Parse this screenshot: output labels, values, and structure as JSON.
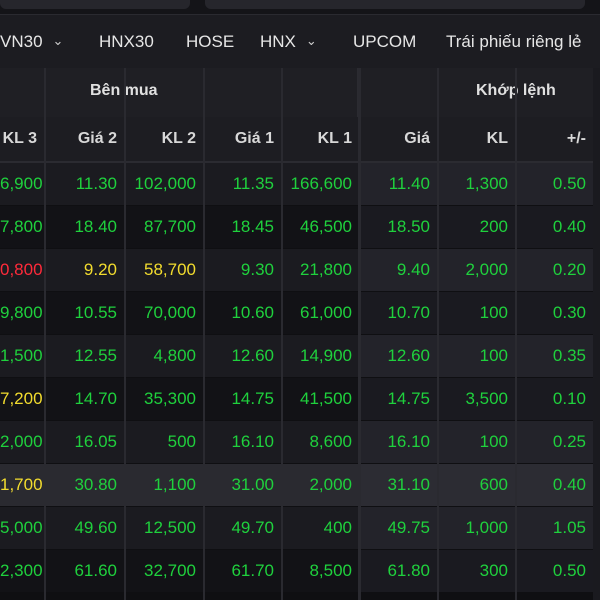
{
  "nav": {
    "items": [
      {
        "label": "VN30",
        "dropdown": true
      },
      {
        "label": "HNX30",
        "dropdown": false
      },
      {
        "label": "HOSE",
        "dropdown": false
      },
      {
        "label": "HNX",
        "dropdown": true
      },
      {
        "label": "UPCOM",
        "dropdown": false
      },
      {
        "label": "Trái phiếu riêng lẻ",
        "dropdown": false
      }
    ],
    "chevron": "⌄"
  },
  "groups": {
    "buy": "Bên mua",
    "match": "Khớp lệnh"
  },
  "columns": [
    "KL 3",
    "Giá 2",
    "KL 2",
    "Giá 1",
    "KL 1",
    "Giá",
    "KL",
    "+/-"
  ],
  "colors": {
    "green": "#1fd13d",
    "yellow": "#f2dc2e",
    "red": "#ff2a3a"
  },
  "rows": [
    {
      "cells": [
        "6,900",
        "11.30",
        "102,000",
        "11.35",
        "166,600",
        "11.40",
        "1,300",
        "0.50"
      ],
      "colors": [
        "green",
        "green",
        "green",
        "green",
        "green",
        "green",
        "green",
        "green"
      ]
    },
    {
      "cells": [
        "7,800",
        "18.40",
        "87,700",
        "18.45",
        "46,500",
        "18.50",
        "200",
        "0.40"
      ],
      "colors": [
        "green",
        "green",
        "green",
        "green",
        "green",
        "green",
        "green",
        "green"
      ]
    },
    {
      "cells": [
        "0,800",
        "9.20",
        "58,700",
        "9.30",
        "21,800",
        "9.40",
        "2,000",
        "0.20"
      ],
      "colors": [
        "red",
        "yellow",
        "yellow",
        "green",
        "green",
        "green",
        "green",
        "green"
      ]
    },
    {
      "cells": [
        "9,800",
        "10.55",
        "70,000",
        "10.60",
        "61,000",
        "10.70",
        "100",
        "0.30"
      ],
      "colors": [
        "green",
        "green",
        "green",
        "green",
        "green",
        "green",
        "green",
        "green"
      ]
    },
    {
      "cells": [
        "1,500",
        "12.55",
        "4,800",
        "12.60",
        "14,900",
        "12.60",
        "100",
        "0.35"
      ],
      "colors": [
        "green",
        "green",
        "green",
        "green",
        "green",
        "green",
        "green",
        "green"
      ]
    },
    {
      "cells": [
        "7,200",
        "14.70",
        "35,300",
        "14.75",
        "41,500",
        "14.75",
        "3,500",
        "0.10"
      ],
      "colors": [
        "yellow",
        "green",
        "green",
        "green",
        "green",
        "green",
        "green",
        "green"
      ]
    },
    {
      "cells": [
        "2,000",
        "16.05",
        "500",
        "16.10",
        "8,600",
        "16.10",
        "100",
        "0.25"
      ],
      "colors": [
        "green",
        "green",
        "green",
        "green",
        "green",
        "green",
        "green",
        "green"
      ]
    },
    {
      "cells": [
        "1,700",
        "30.80",
        "1,100",
        "31.00",
        "2,000",
        "31.10",
        "600",
        "0.40"
      ],
      "colors": [
        "yellow",
        "green",
        "green",
        "green",
        "green",
        "green",
        "green",
        "green"
      ]
    },
    {
      "cells": [
        "5,000",
        "49.60",
        "12,500",
        "49.70",
        "400",
        "49.75",
        "1,000",
        "1.05"
      ],
      "colors": [
        "green",
        "green",
        "green",
        "green",
        "green",
        "green",
        "green",
        "green"
      ]
    },
    {
      "cells": [
        "2,300",
        "61.60",
        "32,700",
        "61.70",
        "8,500",
        "61.80",
        "300",
        "0.50"
      ],
      "colors": [
        "green",
        "green",
        "green",
        "green",
        "green",
        "green",
        "green",
        "green"
      ]
    }
  ]
}
